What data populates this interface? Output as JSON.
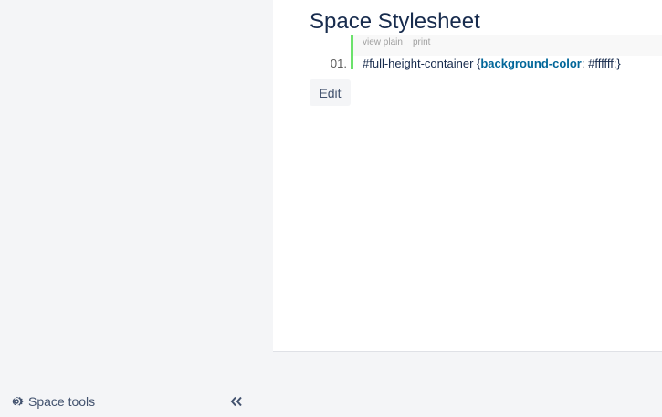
{
  "sidebar": {
    "space_tools": {
      "label": "Space tools",
      "icon": "gear-icon"
    },
    "collapse": {
      "icon": "double-chevron-left-icon"
    }
  },
  "page": {
    "title": "Space Stylesheet"
  },
  "code_block": {
    "toolbar": {
      "view_plain": "view plain",
      "print": "print"
    },
    "lines": [
      {
        "number": "01.",
        "selector": "#full-height-container {",
        "property": "background-color",
        "rest": ": #ffffff;}"
      }
    ],
    "gutter_color": "#6ce26c",
    "keyword_color": "#006699"
  },
  "actions": {
    "edit_label": "Edit"
  }
}
